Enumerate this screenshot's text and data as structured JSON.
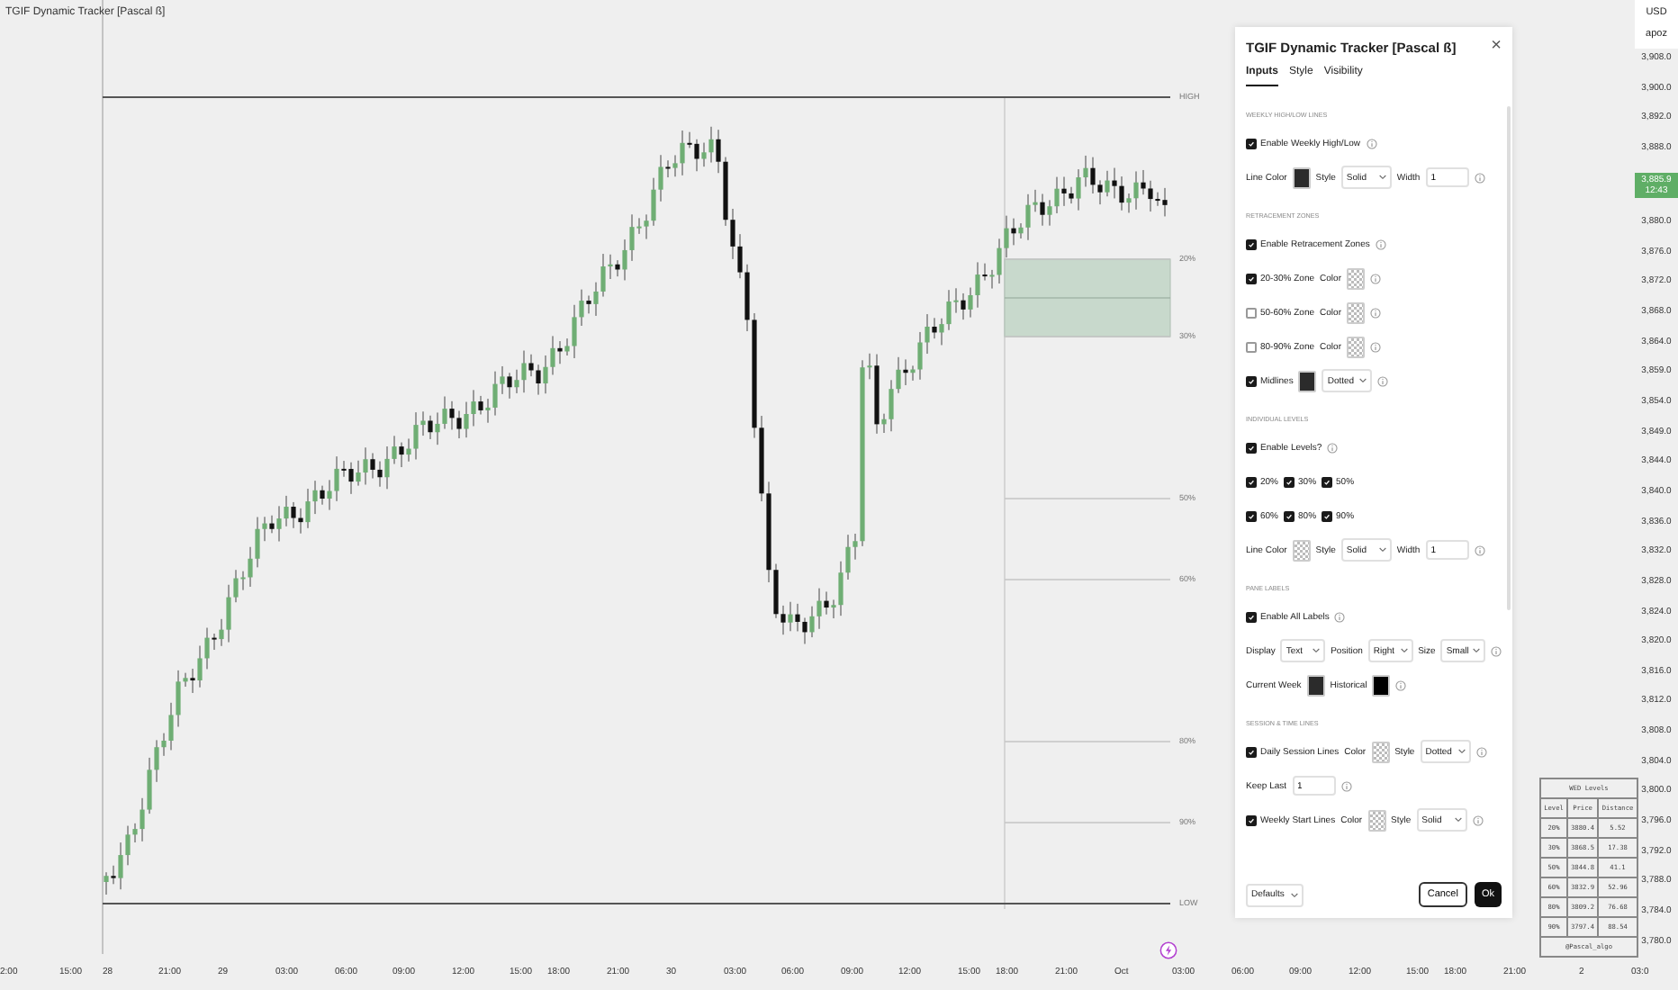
{
  "chart": {
    "indicator_title": "TGIF Dynamic Tracker [Pascal ß]",
    "level_lines": [
      {
        "label": "HIGH",
        "kind": "weekly"
      },
      {
        "label": "20%",
        "kind": "level"
      },
      {
        "label": "30%",
        "kind": "level"
      },
      {
        "label": "50%",
        "kind": "level"
      },
      {
        "label": "60%",
        "kind": "level"
      },
      {
        "label": "80%",
        "kind": "level"
      },
      {
        "label": "90%",
        "kind": "level"
      },
      {
        "label": "LOW",
        "kind": "weekly"
      }
    ],
    "price_axis": {
      "currency": "USD",
      "unit": "apoz",
      "last_price": "3,885.9",
      "countdown": "12:43",
      "ticks_above": [
        "3,908.0",
        "3,900.0",
        "3,892.0",
        "3,888.0"
      ],
      "ticks_below": [
        "3,880.0",
        "3,876.0",
        "3,872.0",
        "3,868.0",
        "3,864.0",
        "3,859.0",
        "3,854.0",
        "3,849.0",
        "3,844.0",
        "3,840.0",
        "3,836.0",
        "3,832.0",
        "3,828.0",
        "3,824.0",
        "3,820.0",
        "3,816.0",
        "3,812.0",
        "3,808.0",
        "3,804.0",
        "3,800.0",
        "3,796.0",
        "3,792.0",
        "3,788.0",
        "3,784.0",
        "3,780.0"
      ]
    },
    "time_axis": [
      "2:00",
      "15:00",
      "28",
      "21:00",
      "29",
      "03:00",
      "06:00",
      "09:00",
      "12:00",
      "15:00",
      "18:00",
      "21:00",
      "30",
      "03:00",
      "06:00",
      "09:00",
      "12:00",
      "15:00",
      "18:00",
      "21:00",
      "Oct",
      "03:00",
      "06:00",
      "09:00",
      "12:00",
      "15:00",
      "18:00",
      "21:00",
      "2",
      "03:0"
    ],
    "levels_table": {
      "title": "WED Levels",
      "columns": [
        "Level",
        "Price",
        "Distance"
      ],
      "rows": [
        [
          "20%",
          "3880.4",
          "5.52"
        ],
        [
          "30%",
          "3868.5",
          "17.38"
        ],
        [
          "50%",
          "3844.8",
          "41.1"
        ],
        [
          "60%",
          "3832.9",
          "52.96"
        ],
        [
          "80%",
          "3809.2",
          "76.68"
        ],
        [
          "90%",
          "3797.4",
          "88.54"
        ]
      ],
      "footer": "@Pascal_algo"
    }
  },
  "dialog": {
    "title": "TGIF Dynamic Tracker [Pascal ß]",
    "close": "×",
    "tabs": [
      {
        "label": "Inputs",
        "selected": true
      },
      {
        "label": "Style",
        "selected": false
      },
      {
        "label": "Visibility",
        "selected": false
      }
    ],
    "sections": [
      {
        "heading": "WEEKLY HIGH/LOW LINES",
        "rows": [
          {
            "items": [
              {
                "kind": "checkbox",
                "label": "Enable Weekly High/Low",
                "checked": true
              },
              {
                "kind": "info"
              }
            ]
          },
          {
            "items": [
              {
                "kind": "label",
                "text": "Line Color"
              },
              {
                "kind": "swatch",
                "color": "#2b2b2b"
              },
              {
                "kind": "label",
                "text": "Style"
              },
              {
                "kind": "select",
                "value": "Solid"
              },
              {
                "kind": "label",
                "text": "Width"
              },
              {
                "kind": "input",
                "value": "1"
              },
              {
                "kind": "info"
              }
            ]
          }
        ]
      },
      {
        "heading": "RETRACEMENT ZONES",
        "rows": [
          {
            "items": [
              {
                "kind": "checkbox",
                "label": "Enable Retracement Zones",
                "checked": true
              },
              {
                "kind": "info"
              }
            ]
          },
          {
            "items": [
              {
                "kind": "checkbox",
                "label": "20-30% Zone",
                "checked": true
              },
              {
                "kind": "label",
                "text": "Color"
              },
              {
                "kind": "swatch_transparent"
              },
              {
                "kind": "info"
              }
            ]
          },
          {
            "items": [
              {
                "kind": "checkbox",
                "label": "50-60% Zone",
                "checked": false
              },
              {
                "kind": "label",
                "text": "Color"
              },
              {
                "kind": "swatch_transparent"
              },
              {
                "kind": "info"
              }
            ]
          },
          {
            "items": [
              {
                "kind": "checkbox",
                "label": "80-90% Zone",
                "checked": false
              },
              {
                "kind": "label",
                "text": "Color"
              },
              {
                "kind": "swatch_transparent"
              },
              {
                "kind": "info"
              }
            ]
          },
          {
            "items": [
              {
                "kind": "checkbox",
                "label": "Midlines",
                "checked": true
              },
              {
                "kind": "swatch",
                "color": "#2b2b2b"
              },
              {
                "kind": "select",
                "value": "Dotted"
              },
              {
                "kind": "info"
              }
            ]
          }
        ]
      },
      {
        "heading": "INDIVIDUAL LEVELS",
        "rows": [
          {
            "items": [
              {
                "kind": "checkbox",
                "label": "Enable Levels?",
                "checked": true
              },
              {
                "kind": "info"
              }
            ]
          },
          {
            "items": [
              {
                "kind": "checkbox",
                "label": "20%",
                "checked": true
              },
              {
                "kind": "checkbox",
                "label": "30%",
                "checked": true
              },
              {
                "kind": "checkbox",
                "label": "50%",
                "checked": true
              }
            ]
          },
          {
            "items": [
              {
                "kind": "checkbox",
                "label": "60%",
                "checked": true
              },
              {
                "kind": "checkbox",
                "label": "80%",
                "checked": true
              },
              {
                "kind": "checkbox",
                "label": "90%",
                "checked": true
              }
            ]
          },
          {
            "items": [
              {
                "kind": "label",
                "text": "Line Color"
              },
              {
                "kind": "swatch_transparent"
              },
              {
                "kind": "label",
                "text": "Style"
              },
              {
                "kind": "select",
                "value": "Solid"
              },
              {
                "kind": "label",
                "text": "Width"
              },
              {
                "kind": "input",
                "value": "1"
              },
              {
                "kind": "info"
              }
            ]
          }
        ]
      },
      {
        "heading": "PANE LABELS",
        "rows": [
          {
            "items": [
              {
                "kind": "checkbox",
                "label": "Enable All Labels",
                "checked": true
              },
              {
                "kind": "info"
              }
            ]
          },
          {
            "items": [
              {
                "kind": "label",
                "text": "Display"
              },
              {
                "kind": "select",
                "value": "Text"
              },
              {
                "kind": "label",
                "text": "Position"
              },
              {
                "kind": "select",
                "value": "Right"
              },
              {
                "kind": "label",
                "text": "Size"
              },
              {
                "kind": "select",
                "value": "Small"
              },
              {
                "kind": "info"
              }
            ]
          },
          {
            "items": [
              {
                "kind": "label",
                "text": "Current Week"
              },
              {
                "kind": "swatch",
                "color": "#2b2b2b"
              },
              {
                "kind": "label",
                "text": "Historical"
              },
              {
                "kind": "swatch",
                "color": "#000000"
              },
              {
                "kind": "info"
              }
            ]
          }
        ]
      },
      {
        "heading": "SESSION & TIME LINES",
        "rows": [
          {
            "items": [
              {
                "kind": "checkbox",
                "label": "Daily Session Lines",
                "checked": true
              },
              {
                "kind": "label",
                "text": "Color"
              },
              {
                "kind": "swatch_transparent"
              },
              {
                "kind": "label",
                "text": "Style"
              },
              {
                "kind": "select",
                "value": "Dotted"
              },
              {
                "kind": "info"
              }
            ]
          },
          {
            "items": [
              {
                "kind": "label",
                "text": "Keep Last"
              },
              {
                "kind": "input",
                "value": "1"
              },
              {
                "kind": "info"
              }
            ]
          },
          {
            "items": [
              {
                "kind": "checkbox",
                "label": "Weekly Start Lines",
                "checked": true
              },
              {
                "kind": "label",
                "text": "Color"
              },
              {
                "kind": "swatch_transparent"
              },
              {
                "kind": "label",
                "text": "Style"
              },
              {
                "kind": "select",
                "value": "Solid"
              },
              {
                "kind": "info"
              }
            ]
          }
        ]
      }
    ],
    "footer": {
      "defaults": "Defaults",
      "cancel": "Cancel",
      "ok": "Ok"
    }
  }
}
